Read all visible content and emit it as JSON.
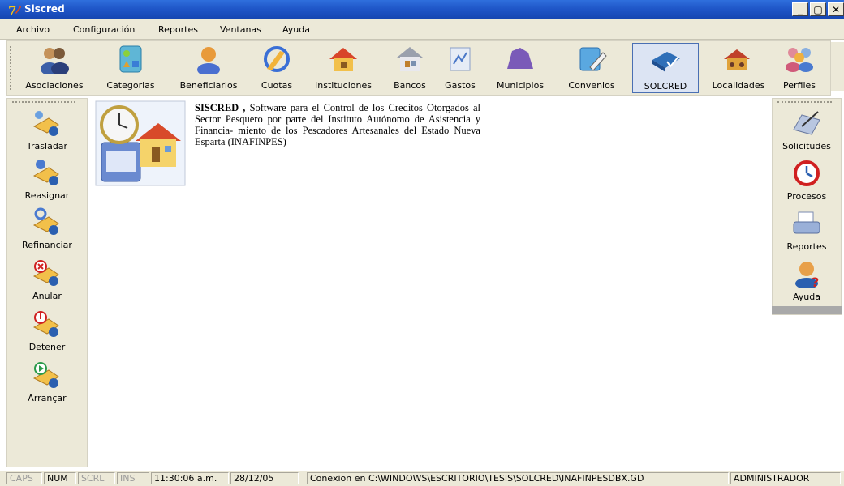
{
  "window": {
    "title": "Siscred"
  },
  "menu": [
    {
      "label": "Archivo"
    },
    {
      "label": "Configuración"
    },
    {
      "label": "Reportes"
    },
    {
      "label": "Ventanas"
    },
    {
      "label": "Ayuda"
    }
  ],
  "toolbar": [
    {
      "label": "Asociaciones",
      "icon": "users-icon"
    },
    {
      "label": "Categorias",
      "icon": "shapes-icon"
    },
    {
      "label": "Beneficiarios",
      "icon": "person-icon"
    },
    {
      "label": "Cuotas",
      "icon": "quota-icon"
    },
    {
      "label": "Instituciones",
      "icon": "house-icon"
    },
    {
      "label": "Bancos",
      "icon": "bank-icon"
    },
    {
      "label": "Gastos",
      "icon": "expenses-icon"
    },
    {
      "label": "Municipios",
      "icon": "map-icon"
    },
    {
      "label": "Convenios",
      "icon": "agreement-icon"
    },
    {
      "label": "SOLCRED",
      "icon": "solcred-icon",
      "active": true
    },
    {
      "label": "Localidades",
      "icon": "village-icon"
    },
    {
      "label": "Perfiles",
      "icon": "profiles-icon"
    }
  ],
  "left_panel": [
    {
      "label": "Trasladar"
    },
    {
      "label": "Reasignar"
    },
    {
      "label": "Refinanciar"
    },
    {
      "label": "Anular"
    },
    {
      "label": "Detener"
    },
    {
      "label": "Arrançar"
    }
  ],
  "right_panel": [
    {
      "label": "Solicitudes"
    },
    {
      "label": "Procesos"
    },
    {
      "label": "Reportes"
    },
    {
      "label": "Ayuda"
    }
  ],
  "about": {
    "app_name": "SISCRED ,",
    "text": "Software para el Control de los Creditos Otorgados al Sector Pesquero por parte del Instituto Autónomo de Asistencia y Financia- miento de los Pescadores Artesanales del Estado Nueva Esparta (INAFINPES)"
  },
  "status": {
    "caps": "CAPS",
    "num": "NUM",
    "scrl": "SCRL",
    "ins": "INS",
    "time": "11:30:06 a.m.",
    "date": "28/12/05",
    "connection": "Conexion en C:\\WINDOWS\\ESCRITORIO\\TESIS\\SOLCRED\\INAFINPESDBX.GD",
    "user": "ADMINISTRADOR"
  },
  "colors": {
    "titlebar": "#1f56c8",
    "chrome": "#ece9d8",
    "active_button": "#dce4f3"
  }
}
